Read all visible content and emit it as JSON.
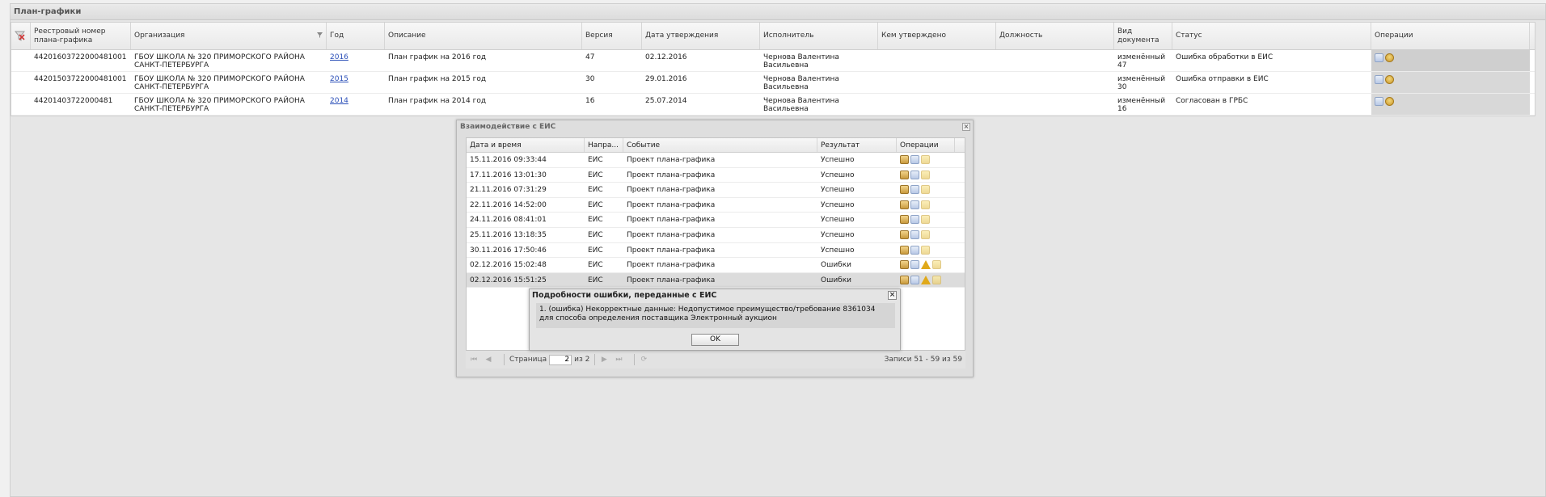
{
  "panel": {
    "title": "План-графики"
  },
  "grid": {
    "columns": [
      "",
      "Реестровый номер плана-графика",
      "Организация",
      "Год",
      "Описание",
      "Версия",
      "Дата утверждения",
      "Исполнитель",
      "Кем утверждено",
      "Должность",
      "Вид документа",
      "Статус",
      "Операции"
    ],
    "rows": [
      {
        "reg_number": "44201603722000481001",
        "org": "ГБОУ ШКОЛА № 320 ПРИМОРСКОГО РАЙОНА САНКТ-ПЕТЕРБУРГА",
        "year": "2016",
        "description": "План график на 2016 год",
        "version": "47",
        "approval_date": "02.12.2016",
        "executor": "Чернова Валентина Васильевна",
        "approved_by": "",
        "position": "",
        "doc_type": "изменённый 47",
        "status": "Ошибка обработки в ЕИС"
      },
      {
        "reg_number": "44201503722000481001",
        "org": "ГБОУ ШКОЛА № 320 ПРИМОРСКОГО РАЙОНА САНКТ-ПЕТЕРБУРГА",
        "year": "2015",
        "description": "План график на 2015 год",
        "version": "30",
        "approval_date": "29.01.2016",
        "executor": "Чернова Валентина Васильевна",
        "approved_by": "",
        "position": "",
        "doc_type": "изменённый 30",
        "status": "Ошибка отправки в ЕИС"
      },
      {
        "reg_number": "44201403722000481",
        "org": "ГБОУ ШКОЛА № 320 ПРИМОРСКОГО РАЙОНА САНКТ-ПЕТЕРБУРГА",
        "year": "2014",
        "description": "План график на 2014 год",
        "version": "16",
        "approval_date": "25.07.2014",
        "executor": "Чернова Валентина Васильевна",
        "approved_by": "",
        "position": "",
        "doc_type": "изменённый 16",
        "status": "Согласован в ГРБС"
      }
    ]
  },
  "eis_window": {
    "title": "Взаимодействие с ЕИС",
    "columns": [
      "Дата и время",
      "Напра...",
      "Событие",
      "Результат",
      "Операции"
    ],
    "rows": [
      {
        "datetime": "15.11.2016 09:33:44",
        "direction": "ЕИС",
        "event": "Проект плана-графика",
        "result": "Успешно",
        "warn": false
      },
      {
        "datetime": "17.11.2016 13:01:30",
        "direction": "ЕИС",
        "event": "Проект плана-графика",
        "result": "Успешно",
        "warn": false
      },
      {
        "datetime": "21.11.2016 07:31:29",
        "direction": "ЕИС",
        "event": "Проект плана-графика",
        "result": "Успешно",
        "warn": false
      },
      {
        "datetime": "22.11.2016 14:52:00",
        "direction": "ЕИС",
        "event": "Проект плана-графика",
        "result": "Успешно",
        "warn": false
      },
      {
        "datetime": "24.11.2016 08:41:01",
        "direction": "ЕИС",
        "event": "Проект плана-графика",
        "result": "Успешно",
        "warn": false
      },
      {
        "datetime": "25.11.2016 13:18:35",
        "direction": "ЕИС",
        "event": "Проект плана-графика",
        "result": "Успешно",
        "warn": false
      },
      {
        "datetime": "30.11.2016 17:50:46",
        "direction": "ЕИС",
        "event": "Проект плана-графика",
        "result": "Успешно",
        "warn": false
      },
      {
        "datetime": "02.12.2016 15:02:48",
        "direction": "ЕИС",
        "event": "Проект плана-графика",
        "result": "Ошибки",
        "warn": true
      },
      {
        "datetime": "02.12.2016 15:51:25",
        "direction": "ЕИС",
        "event": "Проект плана-графика",
        "result": "Ошибки",
        "warn": true
      }
    ],
    "pager": {
      "page_label": "Страница",
      "page_value": "2",
      "of_label": "из 2",
      "records_info": "Записи 51 - 59 из 59"
    }
  },
  "error_dialog": {
    "title": "Подробности ошибки, переданные с ЕИС",
    "message_line1": "1. (ошибка) Некорректные данные: Недопустимое преимущество/требование 8361034",
    "message_line2": "для способа определения поставщика Электронный аукцион",
    "ok_label": "OK"
  }
}
